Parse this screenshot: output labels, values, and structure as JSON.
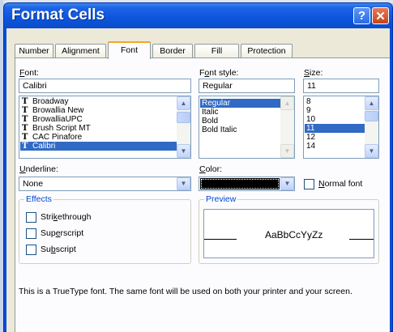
{
  "window": {
    "title": "Format Cells",
    "help_label": "?",
    "close_label": "✕"
  },
  "tabs": [
    {
      "label": "Number",
      "active": false
    },
    {
      "label": "Alignment",
      "active": false
    },
    {
      "label": "Font",
      "active": true
    },
    {
      "label": "Border",
      "active": false
    },
    {
      "label": "Fill",
      "active": false
    },
    {
      "label": "Protection",
      "active": false
    }
  ],
  "font": {
    "label_underlined": "F",
    "label_rest": "ont:",
    "value": "Calibri",
    "items": [
      "Broadway",
      "Browallia New",
      "BrowalliaUPC",
      "Brush Script MT",
      "CAC Pinafore",
      "Calibri"
    ],
    "selected": "Calibri",
    "item_icon": "truetype-icon",
    "item_icon_glyph": "T"
  },
  "font_style": {
    "label_pre": "F",
    "label_underlined": "o",
    "label_rest": "nt style:",
    "value": "Regular",
    "items": [
      "Regular",
      "Italic",
      "Bold",
      "Bold Italic"
    ],
    "selected": "Regular"
  },
  "size": {
    "label_underlined": "S",
    "label_rest": "ize:",
    "value": "11",
    "items": [
      "8",
      "9",
      "10",
      "11",
      "12",
      "14"
    ],
    "selected": "11"
  },
  "underline": {
    "label_underlined": "U",
    "label_rest": "nderline:",
    "value": "None"
  },
  "color": {
    "label_underlined": "C",
    "label_rest": "olor:",
    "value_color": "#000000"
  },
  "normal_font": {
    "label_underlined": "N",
    "label_rest": "ormal font",
    "checked": false
  },
  "effects": {
    "title": "Effects",
    "items": [
      {
        "pre": "Stri",
        "ul": "k",
        "post": "ethrough",
        "checked": false
      },
      {
        "pre": "Sup",
        "ul": "e",
        "post": "rscript",
        "checked": false
      },
      {
        "pre": "Su",
        "ul": "b",
        "post": "script",
        "checked": false
      }
    ]
  },
  "preview": {
    "title": "Preview",
    "sample_text": "AaBbCcYyZz"
  },
  "info_text": "This is a TrueType font.  The same font will be used on both your printer and your screen.",
  "icons": {
    "scroll_up": "▲",
    "scroll_down": "▼"
  },
  "colors": {
    "title_bar": "#0c55dc",
    "selection": "#316ac5",
    "group_title": "#0046d5",
    "active_tab_accent": "#f5a623"
  }
}
